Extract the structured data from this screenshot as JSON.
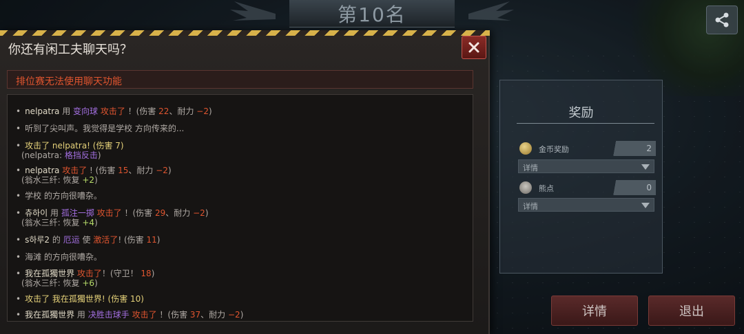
{
  "header": {
    "rank_title": "第10名"
  },
  "chat": {
    "title": "你还有闲工夫聊天吗？",
    "notice": "排位赛无法使用聊天功能",
    "messages": [
      {
        "segs": [
          [
            "nelpatra",
            "n"
          ],
          [
            "  用  ",
            "gy"
          ],
          [
            "变向球",
            "p"
          ],
          [
            "  攻击了",
            "r"
          ],
          [
            " ！(伤害 ",
            "gy"
          ],
          [
            "22",
            "r"
          ],
          [
            "、耐力 ",
            "gy"
          ],
          [
            " −2",
            "r"
          ],
          [
            ")",
            "gy"
          ]
        ]
      },
      {
        "segs": [
          [
            "听到了尖叫声。我觉得是学校 方向传来的...",
            "gy"
          ]
        ]
      },
      {
        "segs": [
          [
            "攻击了 nelpatra! (伤害 7)",
            "y"
          ]
        ],
        "sub": [
          [
            "(nelpatra: ",
            "gy"
          ],
          [
            "格挡反击",
            "p"
          ],
          [
            ")",
            "gy"
          ]
        ]
      },
      {
        "segs": [
          [
            "nelpatra",
            "n"
          ],
          [
            "  攻击了",
            "r"
          ],
          [
            " ! (伤害 ",
            "gy"
          ],
          [
            "15",
            "r"
          ],
          [
            "、耐力 ",
            "gy"
          ],
          [
            " −2",
            "r"
          ],
          [
            ")",
            "gy"
          ]
        ],
        "sub": [
          [
            "(翁水三纤: 恢复 ",
            "gy"
          ],
          [
            "+2",
            "g"
          ],
          [
            ")",
            "gy"
          ]
        ]
      },
      {
        "segs": [
          [
            "学校 的方向很嘈杂。",
            "gy"
          ]
        ]
      },
      {
        "segs": [
          [
            "츄하이",
            "n"
          ],
          [
            "  用  ",
            "gy"
          ],
          [
            "孤注一掷",
            "p"
          ],
          [
            "  攻击了",
            "r"
          ],
          [
            "  ！(伤害 ",
            "gy"
          ],
          [
            "29",
            "r"
          ],
          [
            "、耐力 ",
            "gy"
          ],
          [
            " −2",
            "r"
          ],
          [
            ")",
            "gy"
          ]
        ],
        "sub": [
          [
            "(翁水三纤: 恢复 ",
            "gy"
          ],
          [
            "+4",
            "g"
          ],
          [
            ")",
            "gy"
          ]
        ]
      },
      {
        "segs": [
          [
            "s하루2",
            "n"
          ],
          [
            " 的  ",
            "gy"
          ],
          [
            "厄运",
            "p"
          ],
          [
            "  使  ",
            "gy"
          ],
          [
            "激活了",
            "r"
          ],
          [
            "! (伤害 ",
            "gy"
          ],
          [
            "11",
            "r"
          ],
          [
            ")",
            "gy"
          ]
        ]
      },
      {
        "segs": [
          [
            "海滩 的方向很嘈杂。",
            "gy"
          ]
        ]
      },
      {
        "segs": [
          [
            "我在孤獨世界",
            "n"
          ],
          [
            "  攻击了",
            "r"
          ],
          [
            "！(守卫！ ",
            "gy"
          ],
          [
            "18",
            "r"
          ],
          [
            ")",
            "gy"
          ]
        ],
        "sub": [
          [
            "(翁水三纤: 恢复 ",
            "gy"
          ],
          [
            "+6",
            "g"
          ],
          [
            ")",
            "gy"
          ]
        ]
      },
      {
        "segs": [
          [
            "攻击了 我在孤獨世界! (伤害 10)",
            "y"
          ]
        ]
      },
      {
        "segs": [
          [
            "我在孤獨世界",
            "n"
          ],
          [
            "  用  ",
            "gy"
          ],
          [
            "决胜击球手",
            "p"
          ],
          [
            "  攻击了",
            "r"
          ],
          [
            "  ！(伤害 ",
            "gy"
          ],
          [
            "37",
            "r"
          ],
          [
            "、耐力 ",
            "gy"
          ],
          [
            " −2",
            "r"
          ],
          [
            ")",
            "gy"
          ]
        ]
      }
    ]
  },
  "reward": {
    "title": "奖励",
    "gold": {
      "label": "金币奖励",
      "value": "2",
      "detail": "详情"
    },
    "bear": {
      "label": "熊点",
      "value": "0",
      "detail": "详情"
    }
  },
  "buttons": {
    "detail": "详情",
    "exit": "退出"
  },
  "icons": {
    "share": "share-icon",
    "close": "close-icon",
    "coin": "coin-icon",
    "bear": "bear-icon"
  },
  "colors": {
    "attack": "#e0552f",
    "skill": "#a36fe0",
    "heal": "#b8dd6a",
    "notice": "#e0552f",
    "accent": "#d8b24a"
  }
}
